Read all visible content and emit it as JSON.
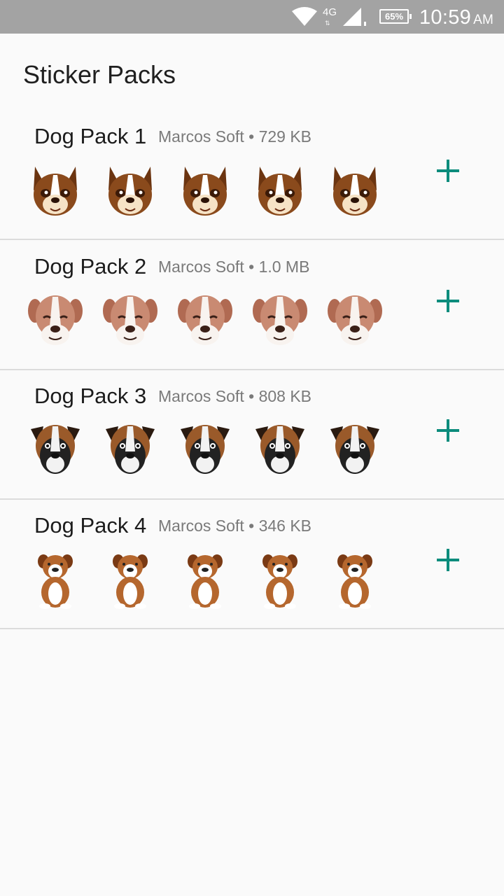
{
  "status_bar": {
    "network": "4G",
    "battery": "65%",
    "time": "10:59",
    "ampm": "AM"
  },
  "page": {
    "title": "Sticker Packs"
  },
  "colors": {
    "accent": "#0c8c7c",
    "status_bar": "#a3a3a3"
  },
  "packs": [
    {
      "name": "Dog Pack 1",
      "publisher": "Marcos Soft",
      "size": "729 KB",
      "add_icon": "plus-icon"
    },
    {
      "name": "Dog Pack 2",
      "publisher": "Marcos Soft",
      "size": "1.0 MB",
      "add_icon": "plus-icon"
    },
    {
      "name": "Dog Pack 3",
      "publisher": "Marcos Soft",
      "size": "808 KB",
      "add_icon": "plus-icon"
    },
    {
      "name": "Dog Pack 4",
      "publisher": "Marcos Soft",
      "size": "346 KB",
      "add_icon": "plus-icon"
    }
  ]
}
